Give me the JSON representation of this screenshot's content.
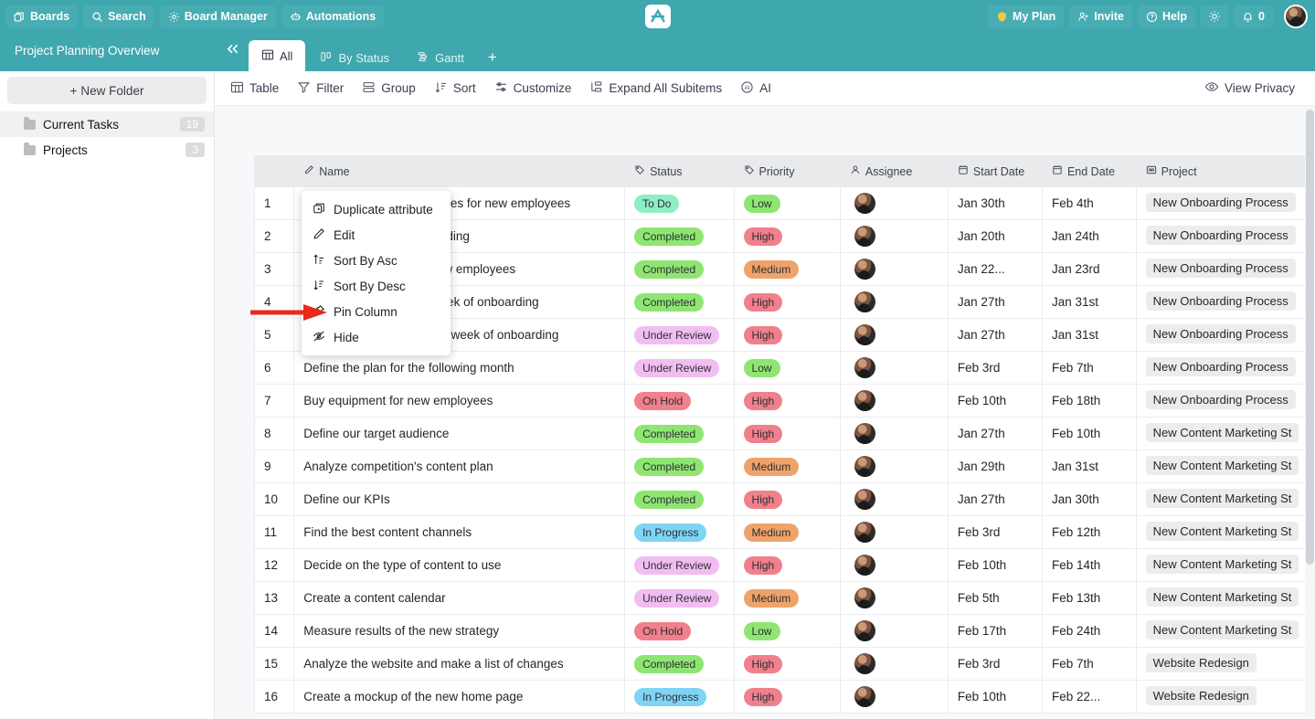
{
  "topbar": {
    "left_buttons": [
      {
        "label": "Boards",
        "icon": "boards-icon"
      },
      {
        "label": "Search",
        "icon": "search-icon"
      },
      {
        "label": "Board Manager",
        "icon": "gear-icon"
      },
      {
        "label": "Automations",
        "icon": "robot-icon"
      }
    ],
    "right_buttons": [
      {
        "label": "My Plan",
        "icon": "shield-icon"
      },
      {
        "label": "Invite",
        "icon": "person-add-icon"
      },
      {
        "label": "Help",
        "icon": "question-circle-icon"
      }
    ],
    "theme_toggle_icon": "sun-icon",
    "notifications": {
      "icon": "bell-icon",
      "count": "0"
    },
    "avatar": "user-avatar",
    "brand_color": "#3fa8ae"
  },
  "secondbar": {
    "board_title": "Project Planning Overview",
    "collapse_icon": "double-chevron-left-icon",
    "tabs": [
      {
        "label": "All",
        "icon": "table-icon",
        "active": true
      },
      {
        "label": "By Status",
        "icon": "kanban-icon",
        "active": false
      },
      {
        "label": "Gantt",
        "icon": "gantt-icon",
        "active": false
      }
    ],
    "add_tab_label": "+"
  },
  "sidebar": {
    "new_folder_label": "New Folder",
    "new_folder_icon": "plus-icon",
    "folders": [
      {
        "label": "Current Tasks",
        "count": "19",
        "selected": true
      },
      {
        "label": "Projects",
        "count": "3",
        "selected": false
      }
    ]
  },
  "toolbar": {
    "items": [
      {
        "label": "Table",
        "icon": "table-icon"
      },
      {
        "label": "Filter",
        "icon": "filter-icon"
      },
      {
        "label": "Group",
        "icon": "group-icon"
      },
      {
        "label": "Sort",
        "icon": "sort-icon"
      },
      {
        "label": "Customize",
        "icon": "sliders-icon"
      },
      {
        "label": "Expand All Subitems",
        "icon": "expand-subitems-icon"
      },
      {
        "label": "AI",
        "icon": "ai-icon"
      }
    ],
    "view_privacy": {
      "label": "View Privacy",
      "icon": "eye-icon"
    }
  },
  "context_menu": {
    "items": [
      {
        "label": "Duplicate attribute",
        "icon": "duplicate-icon"
      },
      {
        "label": "Edit",
        "icon": "pencil-icon"
      },
      {
        "label": "Sort By Asc",
        "icon": "sort-asc-icon"
      },
      {
        "label": "Sort By Desc",
        "icon": "sort-desc-icon"
      },
      {
        "label": "Pin Column",
        "icon": "pin-icon"
      },
      {
        "label": "Hide",
        "icon": "eye-off-icon"
      }
    ],
    "highlighted": "Pin Column"
  },
  "annotation": {
    "arrow_color": "#e8291c",
    "points_at": "Pin Column"
  },
  "table": {
    "columns": [
      {
        "key": "idx",
        "label": "",
        "icon": ""
      },
      {
        "key": "name",
        "label": "Name",
        "icon": "pencil-icon"
      },
      {
        "key": "status",
        "label": "Status",
        "icon": "tag-icon"
      },
      {
        "key": "priority",
        "label": "Priority",
        "icon": "tag-icon"
      },
      {
        "key": "assignee",
        "label": "Assignee",
        "icon": "person-icon"
      },
      {
        "key": "start_date",
        "label": "Start Date",
        "icon": "calendar-icon"
      },
      {
        "key": "end_date",
        "label": "End Date",
        "icon": "calendar-icon"
      },
      {
        "key": "project",
        "label": "Project",
        "icon": "link-icon"
      }
    ],
    "status_colors": {
      "To Do": "#8eeec4",
      "Completed": "#8fe572",
      "Under Review": "#f2bdf0",
      "On Hold": "#f0808b",
      "In Progress": "#7fd4f4"
    },
    "priority_colors": {
      "Low": "#8fe572",
      "Medium": "#efa36a",
      "High": "#f0808b"
    },
    "rows": [
      {
        "idx": "1",
        "name": "Create onboarding resources for new employees",
        "status": "To Do",
        "priority": "Low",
        "start_date": "Jan 30th",
        "end_date": "Feb 4th",
        "project": "New Onboarding Process"
      },
      {
        "idx": "2",
        "name": "Define the plan for onboarding",
        "status": "Completed",
        "priority": "High",
        "start_date": "Jan 20th",
        "end_date": "Jan 24th",
        "project": "New Onboarding Process"
      },
      {
        "idx": "3",
        "name": "Arrange equipment for new employees",
        "status": "Completed",
        "priority": "Medium",
        "start_date": "Jan 22...",
        "end_date": "Jan 23rd",
        "project": "New Onboarding Process"
      },
      {
        "idx": "4",
        "name": "Define the plan for first week of onboarding",
        "status": "Completed",
        "priority": "High",
        "start_date": "Jan 27th",
        "end_date": "Jan 31st",
        "project": "New Onboarding Process"
      },
      {
        "idx": "5",
        "name": "Define the plan for second week of onboarding",
        "status": "Under Review",
        "priority": "High",
        "start_date": "Jan 27th",
        "end_date": "Jan 31st",
        "project": "New Onboarding Process"
      },
      {
        "idx": "6",
        "name": "Define the plan for the following month",
        "status": "Under Review",
        "priority": "Low",
        "start_date": "Feb 3rd",
        "end_date": "Feb 7th",
        "project": "New Onboarding Process"
      },
      {
        "idx": "7",
        "name": "Buy equipment for new employees",
        "status": "On Hold",
        "priority": "High",
        "start_date": "Feb 10th",
        "end_date": "Feb 18th",
        "project": "New Onboarding Process"
      },
      {
        "idx": "8",
        "name": "Define our target audience",
        "status": "Completed",
        "priority": "High",
        "start_date": "Jan 27th",
        "end_date": "Feb 10th",
        "project": "New Content Marketing St"
      },
      {
        "idx": "9",
        "name": "Analyze competition's content plan",
        "status": "Completed",
        "priority": "Medium",
        "start_date": "Jan 29th",
        "end_date": "Jan 31st",
        "project": "New Content Marketing St"
      },
      {
        "idx": "10",
        "name": "Define our KPIs",
        "status": "Completed",
        "priority": "High",
        "start_date": "Jan 27th",
        "end_date": "Jan 30th",
        "project": "New Content Marketing St"
      },
      {
        "idx": "11",
        "name": "Find the best content channels",
        "status": "In Progress",
        "priority": "Medium",
        "start_date": "Feb 3rd",
        "end_date": "Feb 12th",
        "project": "New Content Marketing St"
      },
      {
        "idx": "12",
        "name": "Decide on the type of content to use",
        "status": "Under Review",
        "priority": "High",
        "start_date": "Feb 10th",
        "end_date": "Feb 14th",
        "project": "New Content Marketing St"
      },
      {
        "idx": "13",
        "name": "Create a content calendar",
        "status": "Under Review",
        "priority": "Medium",
        "start_date": "Feb 5th",
        "end_date": "Feb 13th",
        "project": "New Content Marketing St"
      },
      {
        "idx": "14",
        "name": "Measure results of the new strategy",
        "status": "On Hold",
        "priority": "Low",
        "start_date": "Feb 17th",
        "end_date": "Feb 24th",
        "project": "New Content Marketing St"
      },
      {
        "idx": "15",
        "name": "Analyze the website and make a list of changes",
        "status": "Completed",
        "priority": "High",
        "start_date": "Feb 3rd",
        "end_date": "Feb 7th",
        "project": "Website Redesign"
      },
      {
        "idx": "16",
        "name": "Create a mockup of the new home page",
        "status": "In Progress",
        "priority": "High",
        "start_date": "Feb 10th",
        "end_date": "Feb 22...",
        "project": "Website Redesign"
      }
    ]
  }
}
